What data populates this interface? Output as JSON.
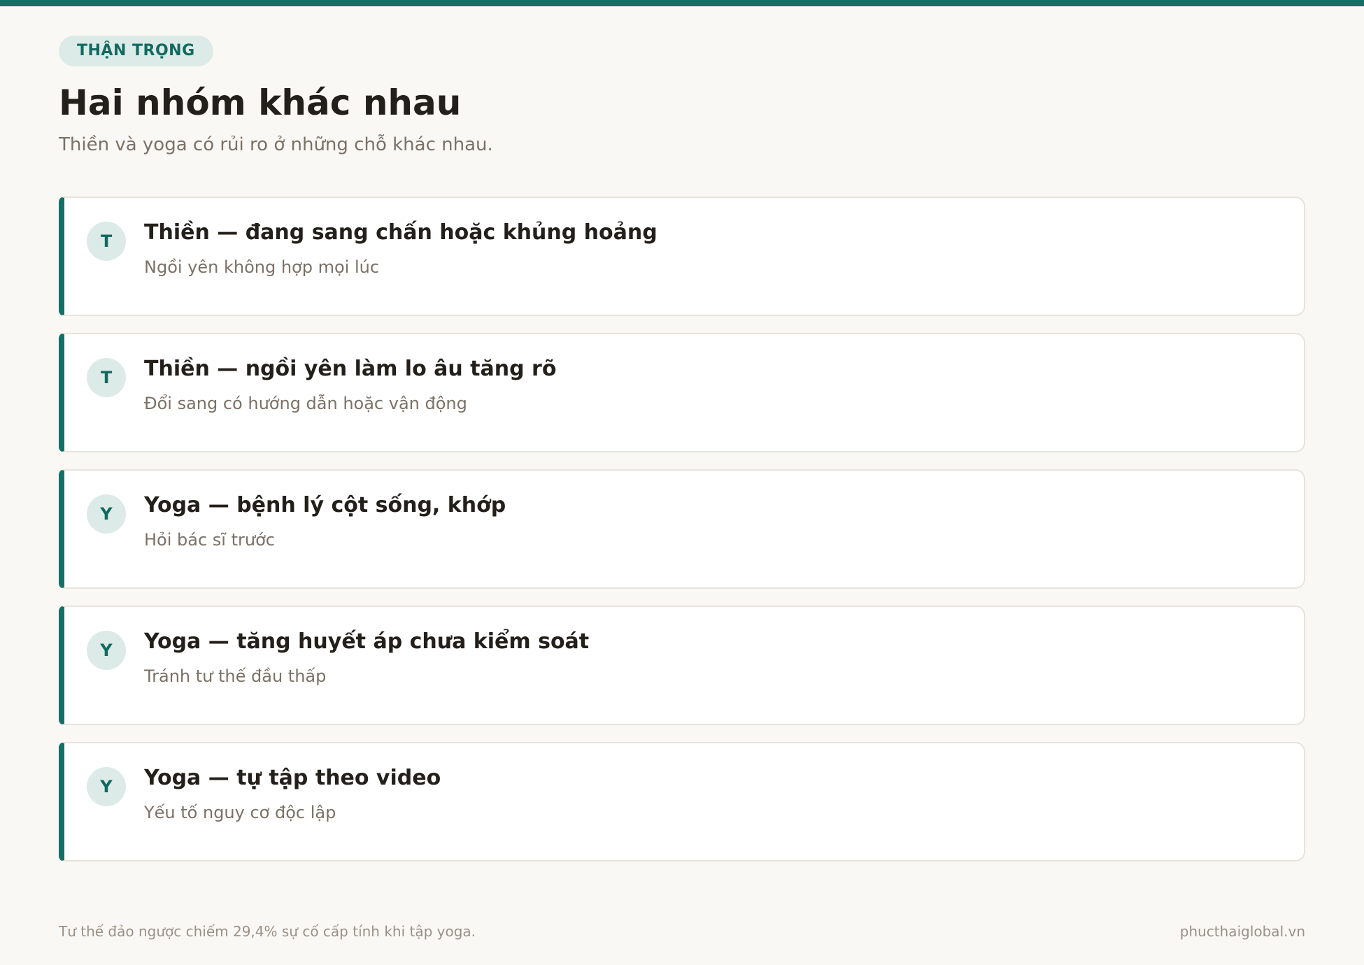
{
  "accent_color": "#137066",
  "badge": "THẬN TRỌNG",
  "title": "Hai nhóm khác nhau",
  "subtitle": "Thiền và yoga có rủi ro ở những chỗ khác nhau.",
  "cards": [
    {
      "initial": "T",
      "title": "Thiền — đang sang chấn hoặc khủng hoảng",
      "desc": "Ngồi yên không hợp mọi lúc"
    },
    {
      "initial": "T",
      "title": "Thiền — ngồi yên làm lo âu tăng rõ",
      "desc": "Đổi sang có hướng dẫn hoặc vận động"
    },
    {
      "initial": "Y",
      "title": "Yoga — bệnh lý cột sống, khớp",
      "desc": "Hỏi bác sĩ trước"
    },
    {
      "initial": "Y",
      "title": "Yoga — tăng huyết áp chưa kiểm soát",
      "desc": "Tránh tư thế đầu thấp"
    },
    {
      "initial": "Y",
      "title": "Yoga — tự tập theo video",
      "desc": "Yếu tố nguy cơ độc lập"
    }
  ],
  "footer": {
    "note": "Tư thế đảo ngược chiếm 29,4% sự cố cấp tính khi tập yoga.",
    "site": "phucthaiglobal.vn"
  }
}
